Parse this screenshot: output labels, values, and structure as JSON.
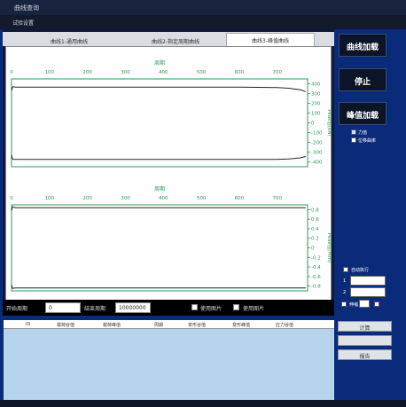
{
  "window": {
    "title": "曲线查询"
  },
  "menu": {
    "item": "试验设置"
  },
  "tabs": [
    {
      "label": "曲线1-通用曲线",
      "active": false
    },
    {
      "label": "曲线2-指定周期曲线",
      "active": false
    },
    {
      "label": "曲线3-峰值曲线",
      "active": true
    }
  ],
  "chart_data": [
    {
      "type": "line",
      "xlabel": "周期",
      "ylabel": "Peak值(kN)",
      "x_ticks": [
        "0",
        "100",
        "200",
        "300",
        "400",
        "500",
        "600",
        "700"
      ],
      "y_ticks": [
        "400",
        "300",
        "200",
        "100",
        "0",
        "-100",
        "-200",
        "-300",
        "-400"
      ],
      "xlim": [
        0,
        780
      ],
      "ylim": [
        -450,
        450
      ],
      "series": [
        {
          "x": [
            0,
            3,
            10,
            100,
            200,
            300,
            400,
            500,
            600,
            700,
            730,
            760,
            775
          ],
          "y": [
            330,
            370,
            365,
            365,
            365,
            365,
            365,
            365,
            365,
            362,
            355,
            340,
            320
          ]
        },
        {
          "x": [
            0,
            3,
            10,
            100,
            200,
            300,
            400,
            500,
            600,
            700,
            730,
            760,
            775
          ],
          "y": [
            -330,
            -375,
            -375,
            -375,
            -375,
            -375,
            -375,
            -375,
            -375,
            -375,
            -370,
            -360,
            -345
          ]
        }
      ]
    },
    {
      "type": "line",
      "xlabel": "周期",
      "ylabel": "Peak值(mm)",
      "x_ticks": [
        "0",
        "100",
        "200",
        "300",
        "400",
        "500",
        "600",
        "700"
      ],
      "y_ticks": [
        "0.8",
        "0.6",
        "0.4",
        "0.2",
        "0",
        "-0.2",
        "-0.4",
        "-0.6",
        "-0.8"
      ],
      "xlim": [
        0,
        780
      ],
      "ylim": [
        -0.9,
        0.9
      ],
      "series": [
        {
          "x": [
            0,
            3,
            10,
            100,
            200,
            300,
            400,
            500,
            600,
            700,
            775
          ],
          "y": [
            0.78,
            0.86,
            0.84,
            0.84,
            0.84,
            0.84,
            0.84,
            0.84,
            0.84,
            0.84,
            0.84
          ]
        },
        {
          "x": [
            0,
            3,
            10,
            100,
            200,
            300,
            400,
            500,
            600,
            700,
            775
          ],
          "y": [
            -0.78,
            -0.85,
            -0.84,
            -0.84,
            -0.84,
            -0.84,
            -0.84,
            -0.84,
            -0.84,
            -0.84,
            -0.84
          ]
        }
      ]
    }
  ],
  "bottombar": {
    "start_label": "开始周期",
    "start_value": "0",
    "end_label": "结束周期",
    "end_value": "10000000",
    "use_image_1": "使用图片",
    "use_image_2": "使用图片"
  },
  "right": {
    "btn_curve_load": "曲线加载",
    "btn_stop": "停止",
    "btn_peak_load": "峰值加载",
    "chk_force": "力值",
    "chk_displacement": "位移曲率",
    "chk_auto": "自动执行",
    "label_1": "1",
    "label_2": "2",
    "chk_range": "伸缩"
  },
  "table": {
    "headers": [
      "ID",
      "载荷谷值",
      "载荷峰值",
      "周期",
      "变形谷值",
      "变形峰值",
      "应力谷值"
    ]
  },
  "sidebuttons": {
    "calc": "计算",
    "report_1": "",
    "report_2": "报告"
  }
}
